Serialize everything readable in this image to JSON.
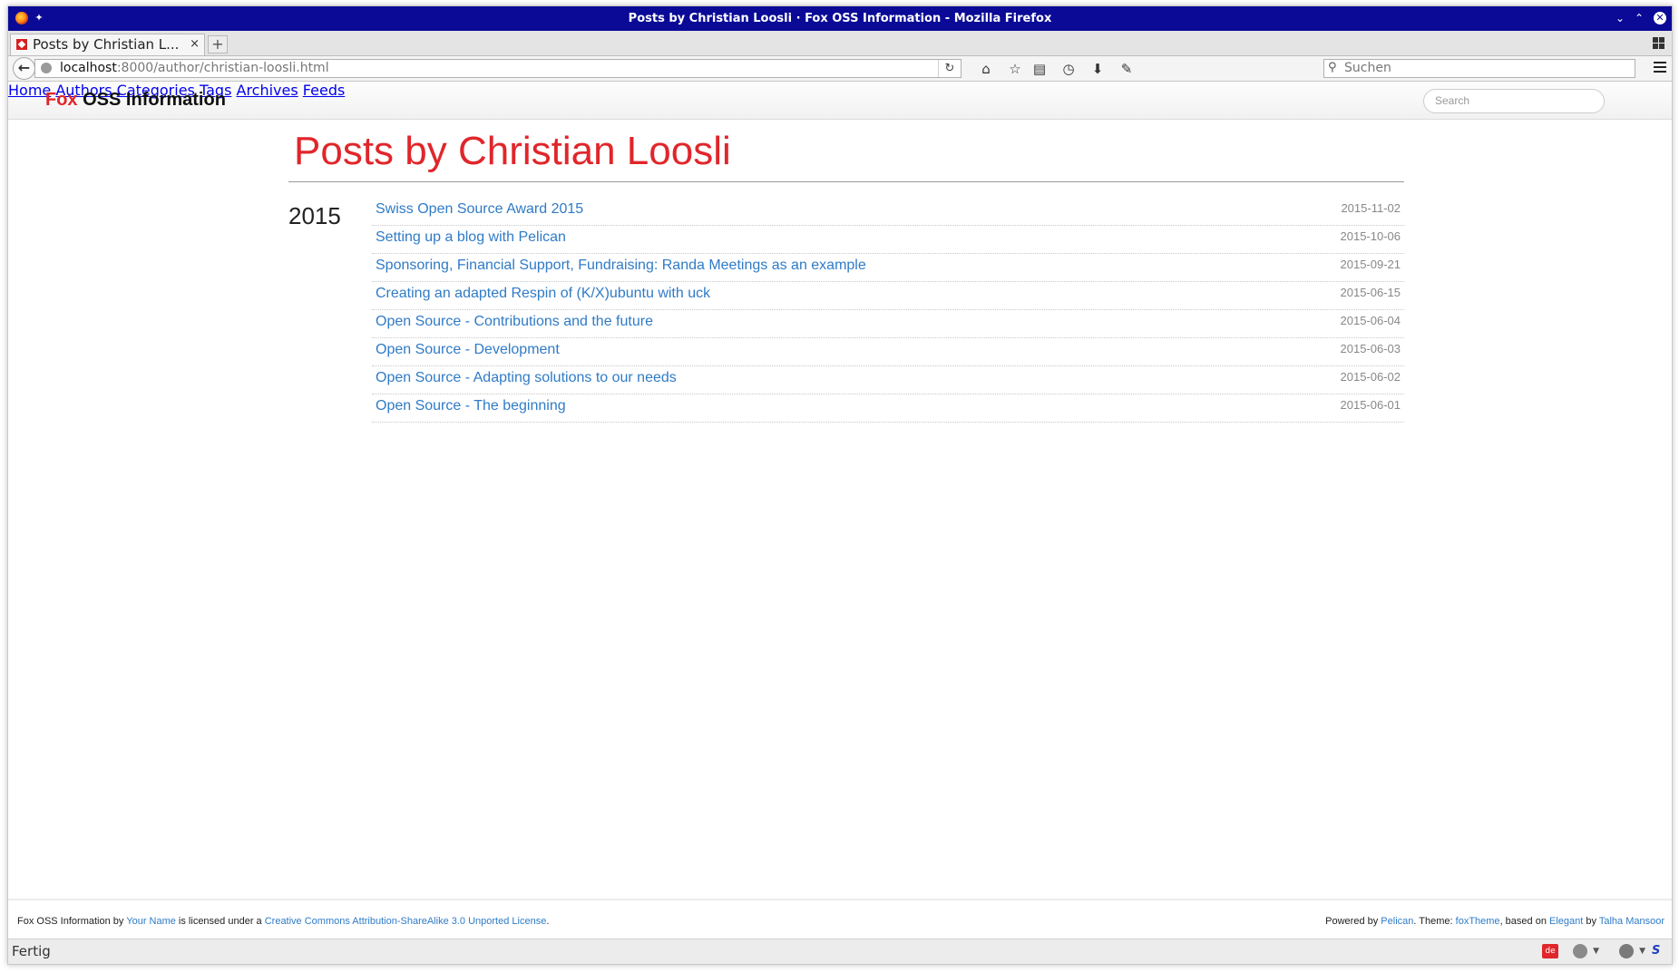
{
  "window": {
    "title": "Posts by Christian Loosli · Fox OSS Information - Mozilla Firefox"
  },
  "browser": {
    "tab_label": "Posts by Christian L...",
    "tab_close": "×",
    "new_tab": "+",
    "url_host": "localhost",
    "url_rest": ":8000/author/christian-loosli.html",
    "search_placeholder": "Suchen",
    "icons": [
      "back-arrow-icon",
      "globe-icon",
      "reload-icon",
      "home-icon",
      "bookmark-star-icon",
      "reading-list-icon",
      "history-icon",
      "download-icon",
      "wrench-icon",
      "search-icon",
      "menu-icon"
    ],
    "status_text": "Fertig",
    "status_badge": "de"
  },
  "site": {
    "brand_accent": "Fox",
    "brand_rest": "OSS Information",
    "nav": [
      "Home",
      "Authors",
      "Categories",
      "Tags",
      "Archives",
      "Feeds"
    ],
    "search_placeholder": "Search",
    "accent_color": "#e0262b",
    "link_color": "#2f7bc7"
  },
  "main": {
    "title": "Posts by Christian Loosli",
    "year": "2015",
    "posts": [
      {
        "title": "Swiss Open Source Award 2015",
        "date": "2015-11-02"
      },
      {
        "title": "Setting up a blog with Pelican",
        "date": "2015-10-06"
      },
      {
        "title": "Sponsoring, Financial Support, Fundraising: Randa Meetings as an example",
        "date": "2015-09-21"
      },
      {
        "title": "Creating an adapted Respin of (K/X)ubuntu with uck",
        "date": "2015-06-15"
      },
      {
        "title": "Open Source - Contributions and the future",
        "date": "2015-06-04"
      },
      {
        "title": "Open Source - Development",
        "date": "2015-06-03"
      },
      {
        "title": "Open Source - Adapting solutions to our needs",
        "date": "2015-06-02"
      },
      {
        "title": "Open Source - The beginning",
        "date": "2015-06-01"
      }
    ]
  },
  "footer": {
    "left_site": "Fox OSS Information",
    "left_by": " by ",
    "left_author": "Your Name",
    "left_mid": " is licensed under a ",
    "left_license": "Creative Commons Attribution-ShareAlike 3.0 Unported License",
    "left_end": ".",
    "right_powered": "Powered by ",
    "right_pelican": "Pelican",
    "right_theme": ". Theme: ",
    "right_foxtheme": "foxTheme",
    "right_based": ", based on ",
    "right_elegant": "Elegant",
    "right_by": " by ",
    "right_author": "Talha Mansoor"
  }
}
